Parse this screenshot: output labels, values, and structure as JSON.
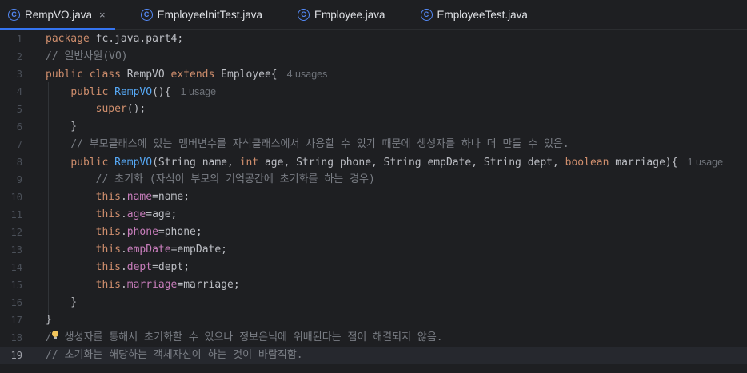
{
  "tabs": [
    {
      "label": "RempVO.java",
      "icon": "class-icon",
      "active": true,
      "close": "×"
    },
    {
      "label": "EmployeeInitTest.java",
      "icon": "class-icon"
    },
    {
      "label": "Employee.java",
      "icon": "class-icon"
    },
    {
      "label": "EmployeeTest.java",
      "icon": "class-icon"
    }
  ],
  "tab_icon_glyph": "C",
  "lines": [
    {
      "n": "1",
      "t": [
        [
          "kw",
          "package "
        ],
        [
          "",
          "fc.java.part4;"
        ]
      ]
    },
    {
      "n": "2",
      "t": [
        [
          "cmt",
          "// 일반사원(VO)"
        ]
      ]
    },
    {
      "n": "3",
      "t": [
        [
          "kw",
          "public class "
        ],
        [
          "",
          "RempVO "
        ],
        [
          "kw",
          "extends "
        ],
        [
          "",
          "Employee{"
        ]
      ],
      "hint": "4 usages"
    },
    {
      "n": "4",
      "t": [
        [
          "",
          "    "
        ],
        [
          "kw",
          "public "
        ],
        [
          "fn",
          "RempVO"
        ],
        [
          "",
          "(){"
        ]
      ],
      "hint": "1 usage"
    },
    {
      "n": "5",
      "t": [
        [
          "",
          "        "
        ],
        [
          "kw",
          "super"
        ],
        [
          "",
          "();"
        ]
      ]
    },
    {
      "n": "6",
      "t": [
        [
          "",
          "    }"
        ]
      ]
    },
    {
      "n": "7",
      "t": [
        [
          "",
          "    "
        ],
        [
          "cmt",
          "// 부모클래스에 있는 멤버변수를 자식클래스에서 사용할 수 있기 때문에 생성자를 하나 더 만들 수 있음."
        ]
      ]
    },
    {
      "n": "8",
      "t": [
        [
          "",
          "    "
        ],
        [
          "kw",
          "public "
        ],
        [
          "fn",
          "RempVO"
        ],
        [
          "",
          "(String name, "
        ],
        [
          "kw",
          "int "
        ],
        [
          "",
          "age, String phone, String empDate, String dept, "
        ],
        [
          "kw",
          "boolean "
        ],
        [
          "",
          "marriage){"
        ]
      ],
      "hint": "1 usage"
    },
    {
      "n": "9",
      "t": [
        [
          "",
          "        "
        ],
        [
          "cmt",
          "// 초기화 (자식이 부모의 기억공간에 초기화를 하는 경우)"
        ]
      ]
    },
    {
      "n": "10",
      "t": [
        [
          "",
          "        "
        ],
        [
          "kw",
          "this"
        ],
        [
          "",
          "."
        ],
        [
          "fld",
          "name"
        ],
        [
          "",
          "=name;"
        ]
      ]
    },
    {
      "n": "11",
      "t": [
        [
          "",
          "        "
        ],
        [
          "kw",
          "this"
        ],
        [
          "",
          "."
        ],
        [
          "fld",
          "age"
        ],
        [
          "",
          "=age;"
        ]
      ]
    },
    {
      "n": "12",
      "t": [
        [
          "",
          "        "
        ],
        [
          "kw",
          "this"
        ],
        [
          "",
          "."
        ],
        [
          "fld",
          "phone"
        ],
        [
          "",
          "=phone;"
        ]
      ]
    },
    {
      "n": "13",
      "t": [
        [
          "",
          "        "
        ],
        [
          "kw",
          "this"
        ],
        [
          "",
          "."
        ],
        [
          "fld",
          "empDate"
        ],
        [
          "",
          "=empDate;"
        ]
      ]
    },
    {
      "n": "14",
      "t": [
        [
          "",
          "        "
        ],
        [
          "kw",
          "this"
        ],
        [
          "",
          "."
        ],
        [
          "fld",
          "dept"
        ],
        [
          "",
          "=dept;"
        ]
      ]
    },
    {
      "n": "15",
      "t": [
        [
          "",
          "        "
        ],
        [
          "kw",
          "this"
        ],
        [
          "",
          "."
        ],
        [
          "fld",
          "marriage"
        ],
        [
          "",
          "=marriage;"
        ]
      ]
    },
    {
      "n": "16",
      "t": [
        [
          "",
          "    }"
        ]
      ]
    },
    {
      "n": "17",
      "t": [
        [
          "",
          "}"
        ]
      ]
    },
    {
      "n": "18",
      "t": [
        [
          "cmt",
          "/"
        ],
        [
          "bulb",
          ""
        ],
        [
          "cmt",
          " 생성자를 통해서 초기화할 수 있으나 정보은닉에 위배된다는 점이 해결되지 않음."
        ]
      ]
    },
    {
      "n": "19",
      "t": [
        [
          "cmt",
          "// 초기화는 해당하는 객체자신이 하는 것이 바람직함."
        ]
      ],
      "current": true
    }
  ],
  "colors": {
    "background": "#1e1f22",
    "keyword": "#cf8e6d",
    "method": "#56a8f5",
    "field": "#c77dbb",
    "comment": "#7a7e85",
    "text": "#bcbec4",
    "tab_underline": "#3574f0"
  }
}
